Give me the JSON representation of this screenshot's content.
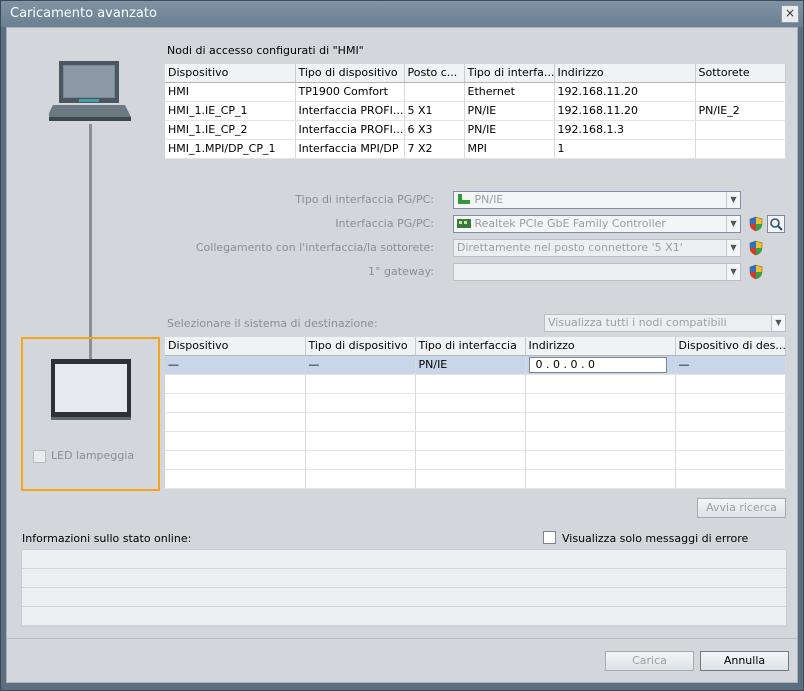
{
  "window": {
    "title": "Caricamento avanzato",
    "close_glyph": "×"
  },
  "top_table": {
    "caption": "Nodi di accesso configurati di \"HMI\"",
    "columns": [
      "Dispositivo",
      "Tipo di dispositivo",
      "Posto c...",
      "Tipo di interfa...",
      "Indirizzo",
      "Sottorete"
    ],
    "rows": [
      [
        "HMI",
        "TP1900 Comfort",
        "",
        "Ethernet",
        "192.168.11.20",
        ""
      ],
      [
        "HMI_1.IE_CP_1",
        "Interfaccia PROFI...",
        "5 X1",
        "PN/IE",
        "192.168.11.20",
        "PN/IE_2"
      ],
      [
        "HMI_1.IE_CP_2",
        "Interfaccia PROFI...",
        "6 X3",
        "PN/IE",
        "192.168.1.3",
        ""
      ],
      [
        "HMI_1.MPI/DP_CP_1",
        "Interfaccia MPI/DP",
        "7 X2",
        "MPI",
        "1",
        ""
      ]
    ]
  },
  "form": {
    "pgpc_type_label": "Tipo di interfaccia PG/PC:",
    "pgpc_type_value": "PN/IE",
    "pgpc_iface_label": "Interfaccia PG/PC:",
    "pgpc_iface_value": "Realtek PCIe GbE Family Controller",
    "connection_label": "Collegamento con l'interfaccia/la sottorete:",
    "connection_value": "Direttamente nel posto connettore '5 X1'",
    "gateway_label": "1° gateway:",
    "gateway_value": ""
  },
  "target": {
    "select_label": "Selezionare il sistema di destinazione:",
    "filter_value": "Visualizza tutti i nodi compatibili",
    "columns": [
      "Dispositivo",
      "Tipo di dispositivo",
      "Tipo di interfaccia",
      "Indirizzo",
      "Dispositivo di des..."
    ],
    "selected_row": [
      "—",
      "—",
      "PN/IE",
      "0   .  0   .  0   .  0",
      "—"
    ],
    "empty_rows": 6
  },
  "led_label": "LED lampeggia",
  "search_button": "Avvia ricerca",
  "status": {
    "label": "Informazioni sullo stato online:",
    "errors_only_label": "Visualizza solo messaggi di errore"
  },
  "buttons": {
    "load": "Carica",
    "cancel": "Annulla"
  },
  "colors": {
    "highlight": "#f5a31a",
    "selection": "#c8d6ea",
    "titlebar": "#7489a0"
  },
  "icons": {
    "pc": "laptop-icon",
    "hmi": "hmi-panel-icon",
    "shield": "security-shield-icon",
    "search": "magnifier-icon",
    "nic": "network-adapter-icon"
  }
}
